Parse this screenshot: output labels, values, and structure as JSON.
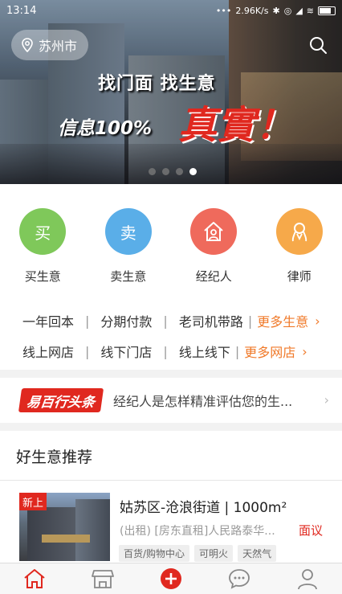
{
  "status_bar": {
    "time": "13:14",
    "network": "2.96K/s"
  },
  "hero": {
    "city": "苏州市",
    "slogan_line1": "找门面 找生意",
    "slogan_line2": "信息100%",
    "slogan_highlight": "真實！",
    "carousel_pages": 4,
    "carousel_active_index": 3
  },
  "categories": [
    {
      "icon_text": "买",
      "label": "买生意",
      "color": "#7fc85a"
    },
    {
      "icon_text": "卖",
      "label": "卖生意",
      "color": "#5aaee8"
    },
    {
      "icon_text": "",
      "label": "经纪人",
      "color": "#ef6a5c",
      "icon": "house-person-icon"
    },
    {
      "icon_text": "",
      "label": "律师",
      "color": "#f6a94a",
      "icon": "lawyer-icon"
    }
  ],
  "quick_links": {
    "row1": [
      "一年回本",
      "分期付款",
      "老司机带路"
    ],
    "row1_more": "更多生意",
    "row2": [
      "线上网店",
      "线下门店",
      "线上线下"
    ],
    "row2_more": "更多网店"
  },
  "headline": {
    "logo": "易百行头条",
    "text": "经纪人是怎样精准评估您的生..."
  },
  "recommend": {
    "title": "好生意推荐"
  },
  "listing": {
    "badge": "新上",
    "title": "姑苏区-沧浪街道 | 1000m²",
    "description": "(出租) [房东直租]人民路泰华...",
    "price": "面议",
    "tags": [
      "百货/购物中心",
      "可明火",
      "天然气"
    ]
  },
  "tabbar": {
    "items": [
      "home-icon",
      "store-icon",
      "publish-icon",
      "message-icon",
      "profile-icon"
    ],
    "accent": "#e0281f"
  }
}
